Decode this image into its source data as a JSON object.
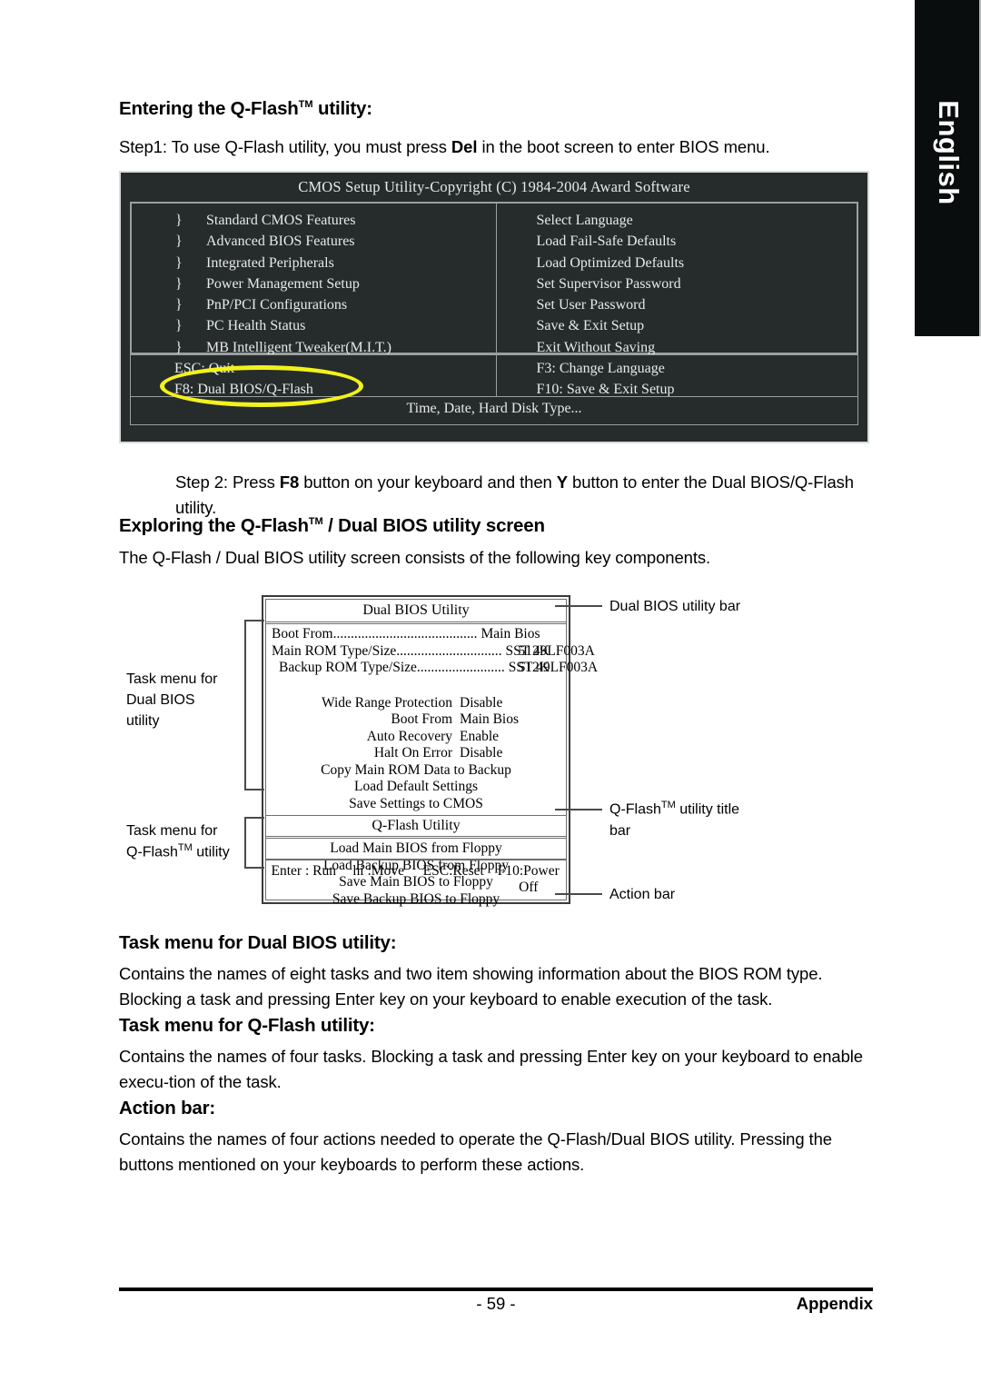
{
  "side_tab": {
    "label": "English"
  },
  "headings": {
    "entering": "Entering the Q-Flash",
    "entering_sup": "TM",
    "entering_tail": " utility:",
    "exploring_a": "Exploring the Q-Flash",
    "exploring_sup": "TM",
    "exploring_tail": " / Dual BIOS utility screen",
    "task_dual": "Task menu for Dual BIOS utility:",
    "task_qflash": "Task menu for Q-Flash utility:",
    "action_bar": "Action bar:"
  },
  "steps": {
    "step1_a": "Step1: To use Q-Flash utility, you must press ",
    "step1_key": "Del",
    "step1_b": " in the boot screen to enter BIOS menu.",
    "step2_a": "Step 2: Press ",
    "step2_key1": "F8",
    "step2_b": " button on your keyboard and then ",
    "step2_key2": "Y",
    "step2_c": " button to enter the Dual BIOS/Q-Flash utility."
  },
  "paragraphs": {
    "exploring_body": "The Q-Flash / Dual BIOS utility screen consists of the following key components.",
    "task_dual_body": "Contains the names of eight tasks and two item showing information about the BIOS ROM type. Blocking a task and pressing Enter key on your keyboard to enable execution of the task.",
    "task_qflash_body": "Contains the names of four tasks. Blocking a task and pressing Enter key on your keyboard to enable execu-tion of the task.",
    "action_bar_body": "Contains the names of four actions needed to operate the Q-Flash/Dual BIOS utility. Pressing the buttons mentioned on your keyboards to perform these actions."
  },
  "bios_screen": {
    "title": "CMOS Setup Utility-Copyright (C) 1984-2004 Award Software",
    "brace": "}",
    "left_items": [
      "Standard CMOS Features",
      "Advanced BIOS Features",
      "Integrated Peripherals",
      "Power Management Setup",
      "PnP/PCI Configurations",
      "PC Health Status",
      "MB Intelligent Tweaker(M.I.T.)"
    ],
    "right_items": [
      "Select Language",
      "Load Fail-Safe Defaults",
      "Load Optimized Defaults",
      "Set Supervisor Password",
      "Set User Password",
      "Save & Exit Setup",
      "Exit Without Saving"
    ],
    "keys_left": [
      "ESC: Quit",
      "F8: Dual BIOS/Q-Flash"
    ],
    "keys_right": [
      "F3: Change Language",
      "F10: Save & Exit Setup"
    ],
    "status": "Time, Date, Hard Disk Type...",
    "highlight_color": "#f2f21c"
  },
  "diagram": {
    "dual_bios_title": "Dual BIOS Utility",
    "info_rows": [
      {
        "label": "Boot From.........................................",
        "value": "Main Bios",
        "size": ""
      },
      {
        "label": "Main ROM Type/Size..............................",
        "value": "SST 49LF003A",
        "size": "512K"
      },
      {
        "label": "Backup ROM Type/Size.........................",
        "value": "SST 49LF003A",
        "size": "512K"
      }
    ],
    "dual_tasks": [
      {
        "name": "Wide Range Protection",
        "value": "Disable"
      },
      {
        "name": "Boot From",
        "value": "Main Bios"
      },
      {
        "name": "Auto Recovery",
        "value": "Enable"
      },
      {
        "name": "Halt On Error",
        "value": "Disable"
      }
    ],
    "dual_tasks_full": [
      "Copy Main ROM Data to Backup",
      "Load Default Settings",
      "Save Settings to CMOS"
    ],
    "qflash_title": "Q-Flash Utility",
    "qflash_tasks": [
      "Load Main BIOS from Floppy",
      "Load Backup BIOS from Floppy",
      "Save Main BIOS to Floppy",
      "Save Backup BIOS to Floppy"
    ],
    "actions": [
      "Enter : Run",
      "hi :Move",
      "ESC:Reset",
      "F10:Power Off"
    ],
    "callouts": {
      "left_dual_a": "Task menu for",
      "left_dual_b": "Dual BIOS",
      "left_dual_c": "utility",
      "left_qflash_a": "Task menu for",
      "left_qflash_b": "Q-Flash",
      "left_qflash_sup": "TM",
      "left_qflash_c": " utility",
      "right_bar": "Dual BIOS utility bar",
      "right_qtitle_a": "Q-Flash",
      "right_qtitle_sup": "TM",
      "right_qtitle_b": " utility title",
      "right_qtitle_c": "bar",
      "right_action": "Action bar"
    }
  },
  "footer": {
    "page_number": "- 59 -",
    "section": "Appendix"
  }
}
